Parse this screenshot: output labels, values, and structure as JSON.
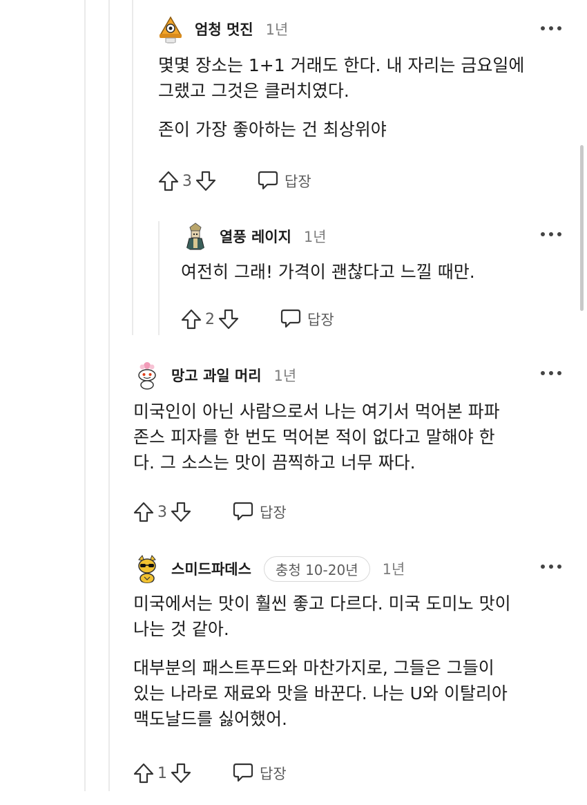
{
  "comments": [
    {
      "author": "엄청 멋진",
      "age": "1년",
      "avatar_icon": "pizza-slice-avatar-icon",
      "paragraphs": [
        "몇몇 장소는 1+1 거래도 한다. 내 자리는 금요일에",
        "그랬고 그것은 클러치였다.",
        "존이 가장 좋아하는 건 최상위야"
      ],
      "score": "3",
      "reply_label": "답장"
    },
    {
      "author": "열풍 레이지",
      "age": "1년",
      "avatar_icon": "warrior-avatar-icon",
      "paragraphs": [
        "여전히 그래! 가격이 괜찮다고 느낄 때만."
      ],
      "score": "2",
      "reply_label": "답장"
    },
    {
      "author": "망고 과일 머리",
      "age": "1년",
      "avatar_icon": "snoo-flower-avatar-icon",
      "paragraphs": [
        "미국인이 아닌 사람으로서 나는 여기서 먹어본 파파",
        "존스 피자를 한 번도 먹어본 적이 없다고 말해야 한",
        "다. 그 소스는 맛이 끔찍하고 너무 짜다."
      ],
      "score": "3",
      "reply_label": "답장"
    },
    {
      "author": "스미드파데스",
      "flair": "충청 10-20년",
      "age": "1년",
      "avatar_icon": "cat-sunglasses-avatar-icon",
      "paragraphs": [
        "미국에서는 맛이 훨씬 좋고 다르다. 미국 도미노 맛이",
        "나는 것 같아.",
        "대부분의 패스트푸드와 마찬가지로, 그들은 그들이",
        "있는 나라로 재료와 맛을 바꾼다. 나는 U와 이탈리아",
        "맥도날드를 싫어했어."
      ],
      "score": "1",
      "reply_label": "답장"
    }
  ],
  "colors": {
    "text": "#1c1c1c",
    "muted": "#7c7c7c",
    "thread_line": "#eaeaea",
    "flair_border": "#d8d8d8"
  }
}
